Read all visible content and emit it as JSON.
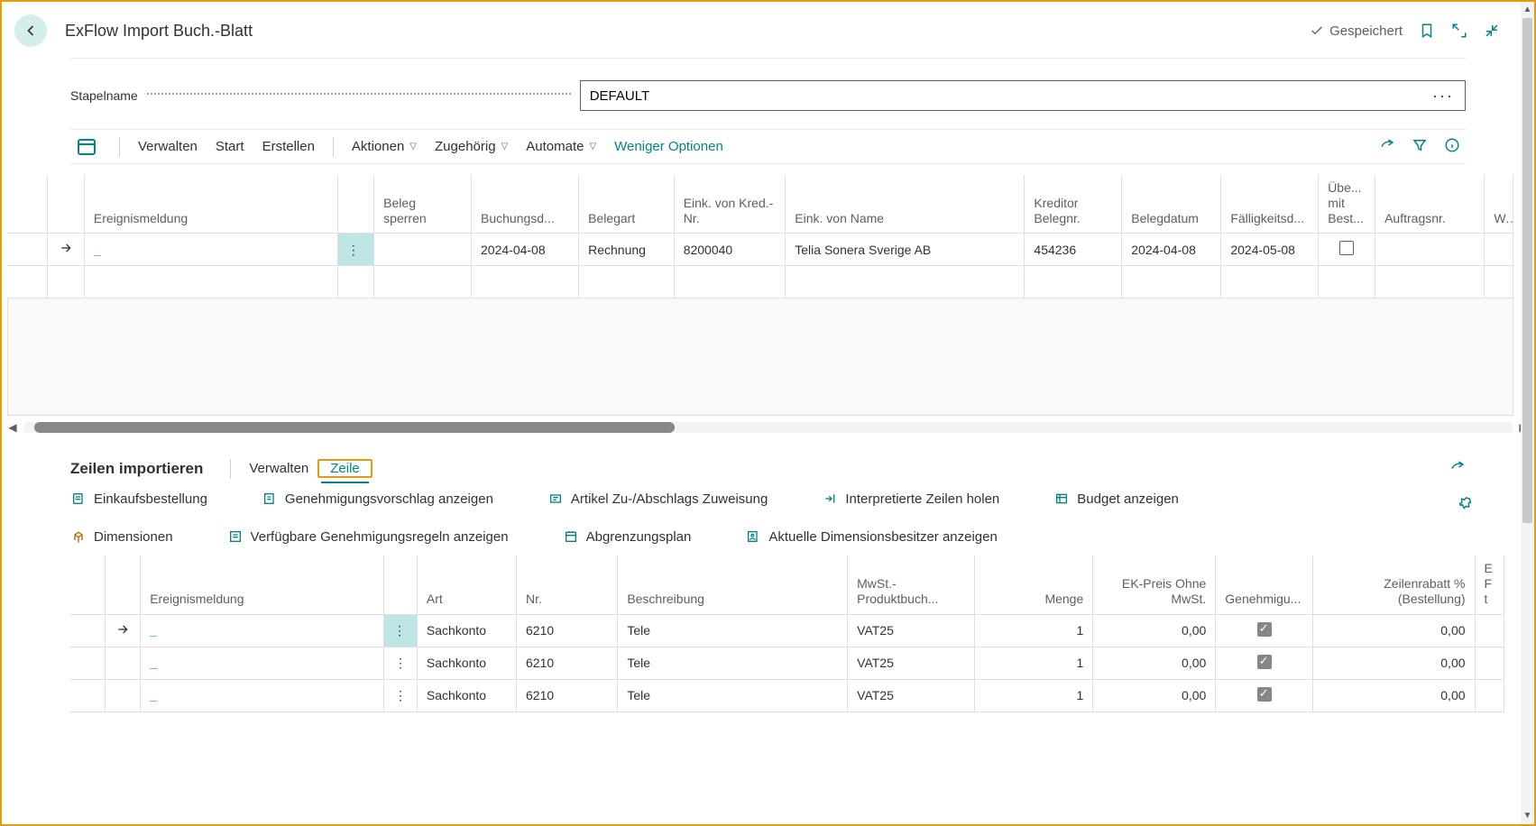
{
  "header": {
    "title": "ExFlow Import Buch.-Blatt",
    "saved_label": "Gespeichert"
  },
  "field": {
    "label": "Stapelname",
    "value": "DEFAULT"
  },
  "toolbar": {
    "manage": "Verwalten",
    "start": "Start",
    "create": "Erstellen",
    "actions": "Aktionen",
    "related": "Zugehörig",
    "automate": "Automate",
    "fewer": "Weniger Optionen"
  },
  "main_grid": {
    "headers": {
      "event": "Ereignismeldung",
      "block": "Beleg sperren",
      "posting_date": "Buchungsd...",
      "doc_type": "Belegart",
      "vendor_no": "Eink. von Kred.-Nr.",
      "vendor_name": "Eink. von Name",
      "cred_docno": "Kreditor Belegnr.",
      "doc_date": "Belegdatum",
      "due_date": "Fälligkeitsd...",
      "match_order": "Übe... mit Best...",
      "order_no": "Auftragsnr.",
      "w": "W..."
    },
    "rows": [
      {
        "posting_date": "2024-04-08",
        "doc_type": "Rechnung",
        "vendor_no": "8200040",
        "vendor_name": "Telia Sonera Sverige AB",
        "cred_docno": "454236",
        "doc_date": "2024-04-08",
        "due_date": "2024-05-08",
        "match_order": false
      }
    ]
  },
  "sub": {
    "title": "Zeilen importieren",
    "manage": "Verwalten",
    "tab_line": "Zeile"
  },
  "actions": {
    "a1": "Einkaufsbestellung",
    "a2": "Genehmigungsvorschlag anzeigen",
    "a3": "Artikel Zu-/Abschlags Zuweisung",
    "a4": "Interpretierte Zeilen holen",
    "a5": "Budget anzeigen",
    "a6": "Dimensionen",
    "a7": "Verfügbare Genehmigungsregeln anzeigen",
    "a8": "Abgrenzungsplan",
    "a9": "Aktuelle Dimensionsbesitzer anzeigen"
  },
  "sub_grid": {
    "headers": {
      "event": "Ereignismeldung",
      "type": "Art",
      "no": "Nr.",
      "desc": "Beschreibung",
      "vat": "MwSt.-Produktbuch...",
      "qty": "Menge",
      "price": "EK-Preis Ohne MwSt.",
      "approve": "Genehmigu...",
      "discount": "Zeilenrabatt % (Bestellung)",
      "last": "E F t..."
    },
    "rows": [
      {
        "type": "Sachkonto",
        "no": "6210",
        "desc": "Tele",
        "vat": "VAT25",
        "qty": "1",
        "price": "0,00",
        "approve": true,
        "discount": "0,00"
      },
      {
        "type": "Sachkonto",
        "no": "6210",
        "desc": "Tele",
        "vat": "VAT25",
        "qty": "1",
        "price": "0,00",
        "approve": true,
        "discount": "0,00"
      },
      {
        "type": "Sachkonto",
        "no": "6210",
        "desc": "Tele",
        "vat": "VAT25",
        "qty": "1",
        "price": "0,00",
        "approve": true,
        "discount": "0,00"
      }
    ]
  }
}
